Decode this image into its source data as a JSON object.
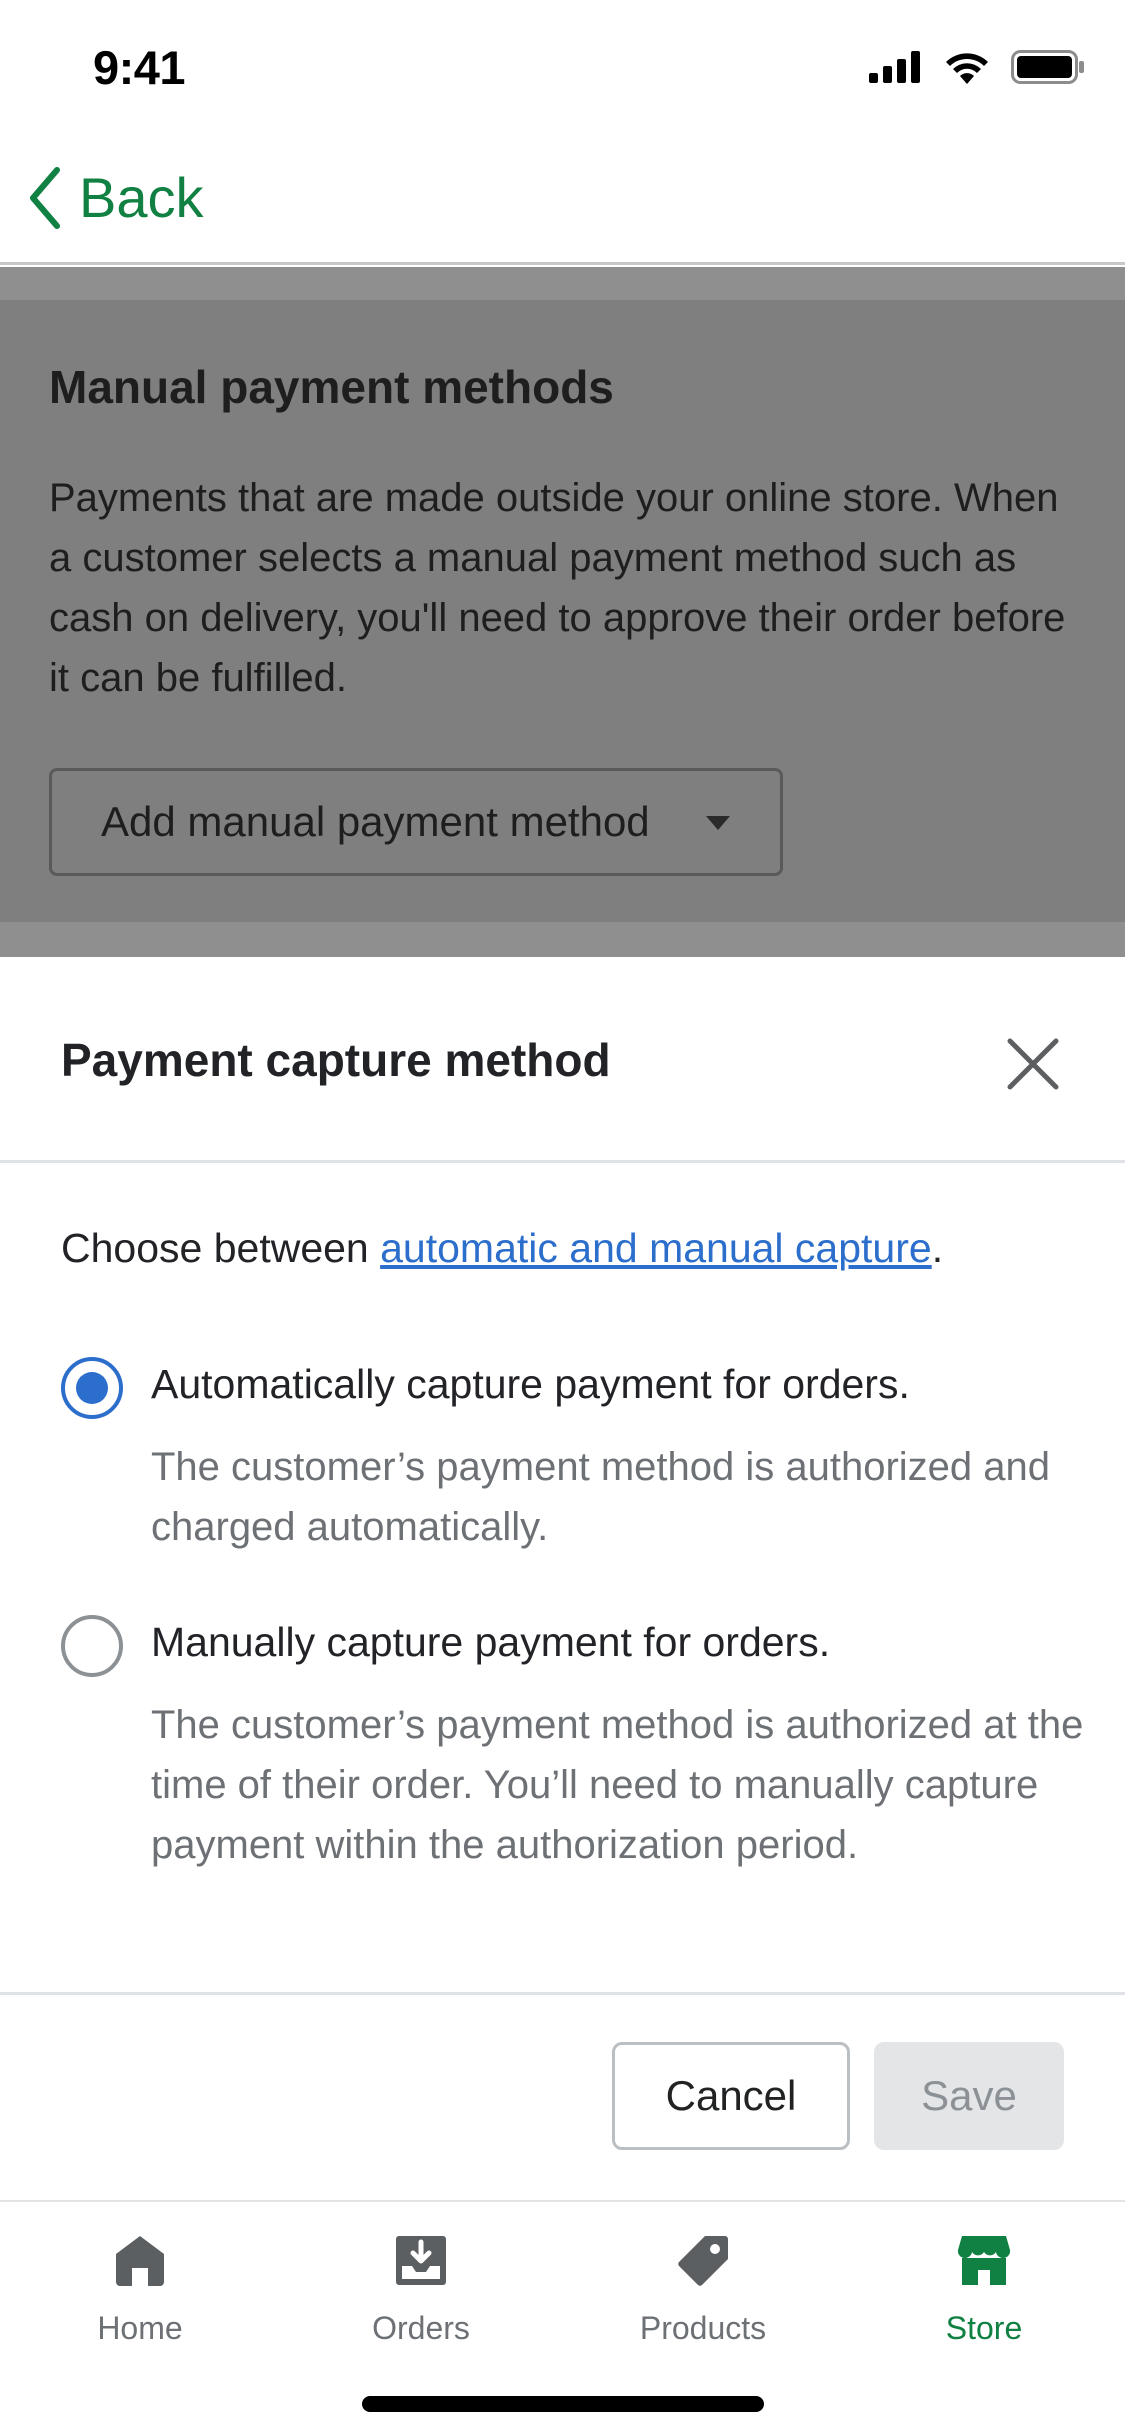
{
  "status_bar": {
    "time": "9:41"
  },
  "nav": {
    "back_label": "Back"
  },
  "background_card": {
    "title": "Manual payment methods",
    "description": "Payments that are made outside your online store. When a customer selects a manual payment method such as cash on delivery, you'll need to approve their order before it can be fulfilled.",
    "select_label": "Add manual payment method"
  },
  "modal": {
    "title": "Payment capture method",
    "intro_prefix": "Choose between ",
    "intro_link": "automatic and manual capture",
    "intro_suffix": ".",
    "options": [
      {
        "label": "Automatically capture payment for orders.",
        "help": "The customer’s payment method is authorized and charged automatically.",
        "selected": true
      },
      {
        "label": "Manually capture payment for orders.",
        "help": "The customer’s payment method is authorized at the time of their order. You’ll need to manually capture payment within the authorization period.",
        "selected": false
      }
    ],
    "cancel_label": "Cancel",
    "save_label": "Save"
  },
  "tab_bar": {
    "tabs": [
      {
        "label": "Home",
        "icon": "home-icon",
        "active": false
      },
      {
        "label": "Orders",
        "icon": "orders-icon",
        "active": false
      },
      {
        "label": "Products",
        "icon": "tag-icon",
        "active": false
      },
      {
        "label": "Store",
        "icon": "store-icon",
        "active": true
      }
    ]
  },
  "colors": {
    "accent_green": "#108043",
    "link_blue": "#2c6ecb",
    "overlay_gray": "#8f8f8f",
    "muted_text": "#6d7175"
  }
}
